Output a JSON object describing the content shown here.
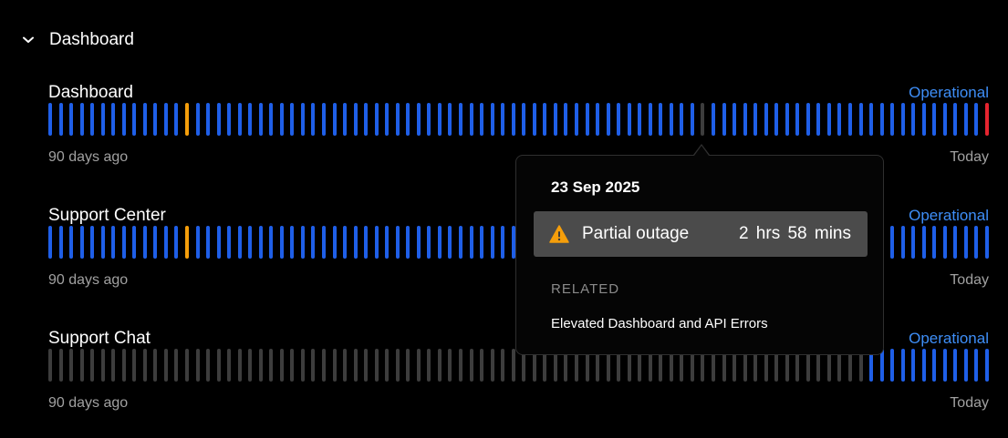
{
  "group": {
    "title": "Dashboard",
    "chevron_icon": "chevron-down-icon"
  },
  "colors": {
    "operational": "#1f5fe8",
    "degraded": "#f59e0b",
    "major": "#e5242f",
    "nodata": "#3d3d3d",
    "status_text": "#3e8ef7"
  },
  "components": [
    {
      "name": "Dashboard",
      "status": "Operational",
      "days": [
        "operational",
        "operational",
        "operational",
        "operational",
        "operational",
        "operational",
        "operational",
        "operational",
        "operational",
        "operational",
        "operational",
        "operational",
        "operational",
        "operational",
        "operational",
        "operational",
        "operational",
        "operational",
        "operational",
        "operational",
        "operational",
        "operational",
        "operational",
        "operational",
        "operational",
        "operational",
        "operational",
        "operational",
        "operational",
        "operational",
        "operational",
        "operational",
        "operational",
        "operational",
        "operational",
        "operational",
        "operational",
        "operational",
        "operational",
        "operational",
        "operational",
        "operational",
        "operational",
        "operational",
        "operational",
        "operational",
        "operational",
        "operational",
        "operational",
        "operational",
        "operational",
        "operational",
        "operational",
        "operational",
        "operational",
        "operational",
        "operational",
        "operational",
        "operational",
        "operational",
        "operational",
        "operational",
        "operational",
        "operational",
        "operational",
        "operational",
        "operational",
        "operational",
        "operational",
        "operational",
        "operational",
        "operational",
        "operational",
        "operational",
        "operational",
        "operational",
        "operational",
        "operational",
        "operational",
        "operational",
        "operational",
        "operational",
        "operational",
        "operational",
        "operational",
        "operational",
        "operational",
        "operational",
        "operational",
        "major"
      ],
      "degraded_days": [
        13
      ],
      "hover_day": 62,
      "left_label": "90 days ago",
      "right_label": "Today"
    },
    {
      "name": "Support Center",
      "status": "Operational",
      "days": [],
      "degraded_days": [
        13
      ],
      "left_label": "90 days ago",
      "right_label": "Today"
    },
    {
      "name": "Support Chat",
      "status": "Operational",
      "days": [],
      "nodata_until": 78,
      "left_label": "90 days ago",
      "right_label": "Today"
    }
  ],
  "tooltip": {
    "date": "23 Sep 2025",
    "incident_icon": "warning-icon",
    "incident_label": "Partial outage",
    "incident_duration": "2 hrs  58 mins",
    "related_heading": "RELATED",
    "related_items": [
      "Elevated Dashboard and API Errors"
    ]
  }
}
